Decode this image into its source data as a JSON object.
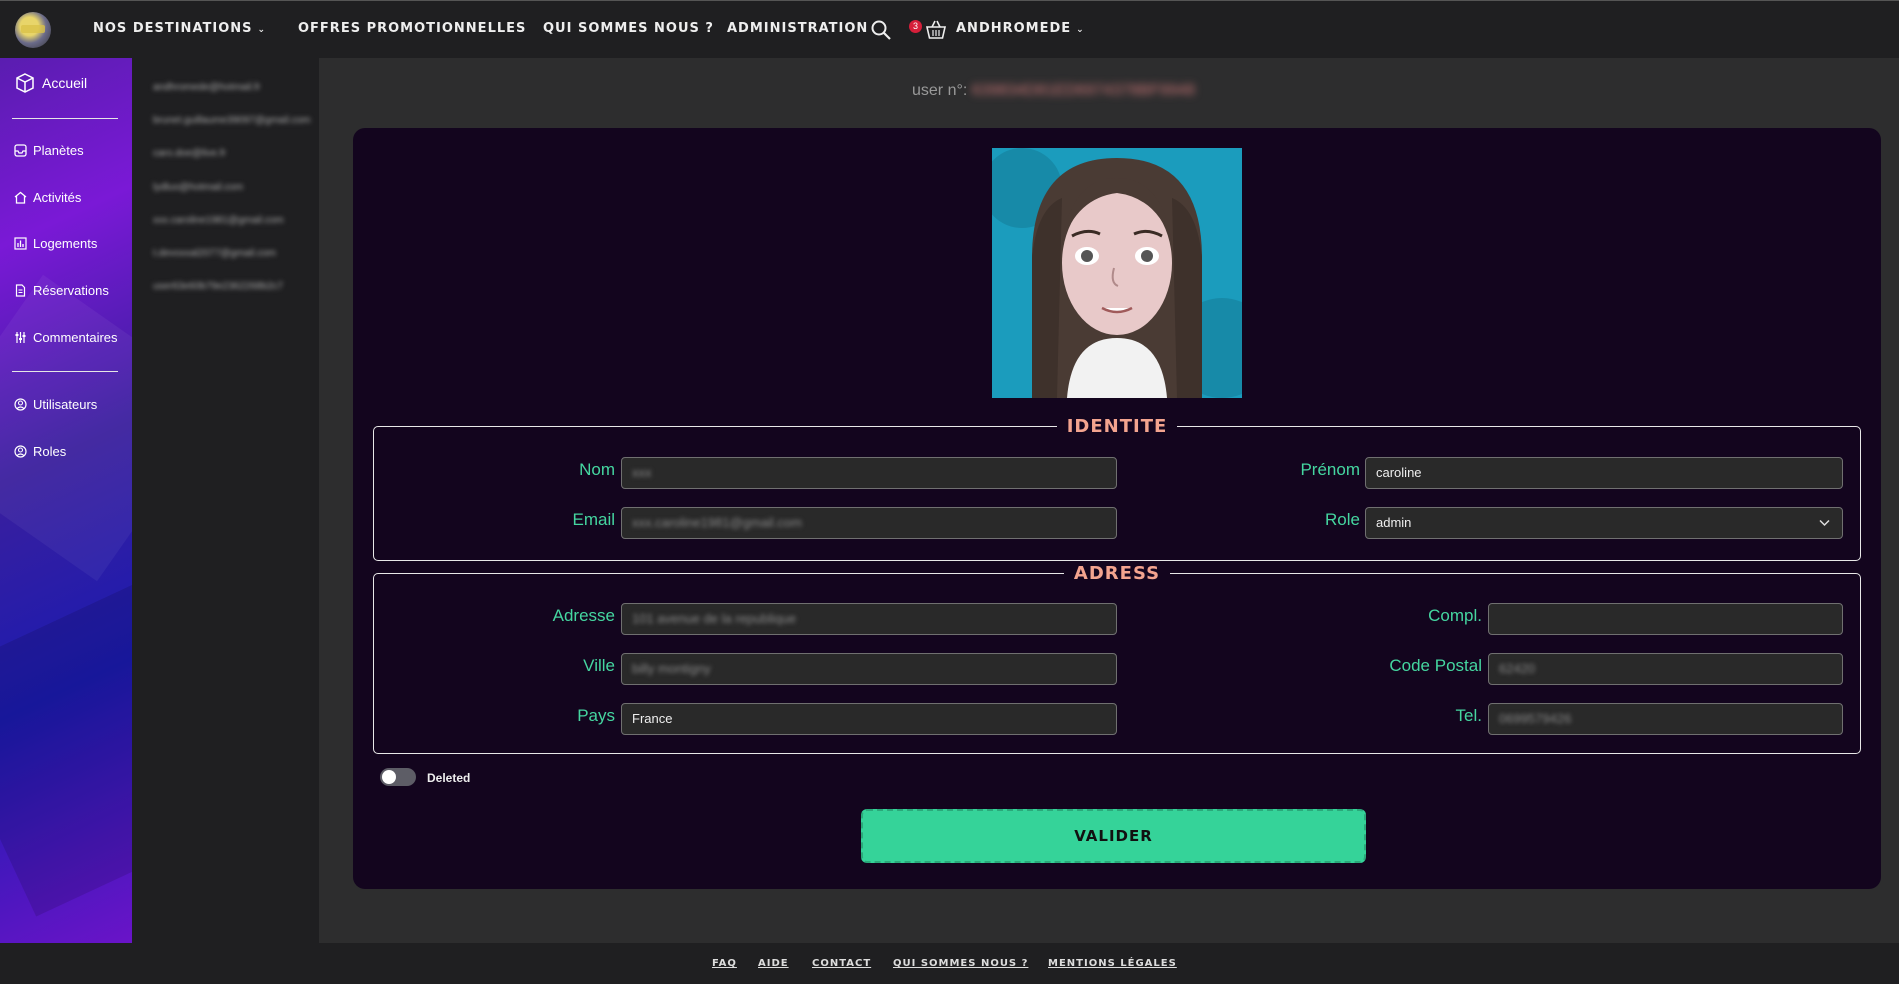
{
  "nav": {
    "destinations": "Nos destinations",
    "offres": "Offres promotionnelles",
    "qui": "Qui sommes nous ?",
    "admin": "Administration",
    "cart_count": "3",
    "user": "Andhromede"
  },
  "sidebar": {
    "items": [
      {
        "label": "Accueil",
        "icon": "cube-icon"
      },
      {
        "label": "Planètes",
        "icon": "inbox-icon"
      },
      {
        "label": "Activités",
        "icon": "house-icon"
      },
      {
        "label": "Logements",
        "icon": "chart-icon"
      },
      {
        "label": "Réservations",
        "icon": "document-icon"
      },
      {
        "label": "Commentaires",
        "icon": "sliders-icon"
      },
      {
        "label": "Utilisateurs",
        "icon": "user-circle-icon"
      },
      {
        "label": "Roles",
        "icon": "user-circle-icon"
      }
    ]
  },
  "users_list": [
    "andhromede@hotmail.fr",
    "brunet.guillaume39097@gmail.com",
    "caro.doe@live.fr",
    "lydluo@hotmail.com",
    "xxx.caroline1981@gmail.com",
    "t.devoxxal2077@gmail.com",
    "user63e60b79e2362268b2c7"
  ],
  "main": {
    "user_label": "user n°:",
    "user_id": "639834D81ED6974378BF9948"
  },
  "identite": {
    "legend": "Identite",
    "nom_label": "Nom",
    "nom_value": "xxx",
    "prenom_label": "Prénom",
    "prenom_value": "caroline",
    "email_label": "Email",
    "email_value": "xxx.caroline1981@gmail.com",
    "role_label": "Role",
    "role_value": "admin"
  },
  "adress": {
    "legend": "Adress",
    "adresse_label": "Adresse",
    "adresse_value": "101 avenue de la republique",
    "compl_label": "Compl.",
    "compl_value": "",
    "ville_label": "Ville",
    "ville_value": "billy montigny",
    "cp_label": "Code Postal",
    "cp_value": "62420",
    "pays_label": "Pays",
    "pays_value": "France",
    "tel_label": "Tel.",
    "tel_value": "0699579426"
  },
  "deleted_label": "Deleted",
  "valider_label": "Valider",
  "footer": {
    "faq": "FAQ",
    "aide": "Aide",
    "contact": "Contact",
    "qui": "Qui sommes nous ?",
    "mentions": "Mentions légales"
  },
  "colors": {
    "accent_green": "#35d399",
    "legend_salmon": "#f3a48f",
    "label_green": "#45d6a0",
    "card_bg": "#13051e",
    "badge_red": "#d61f3a"
  }
}
